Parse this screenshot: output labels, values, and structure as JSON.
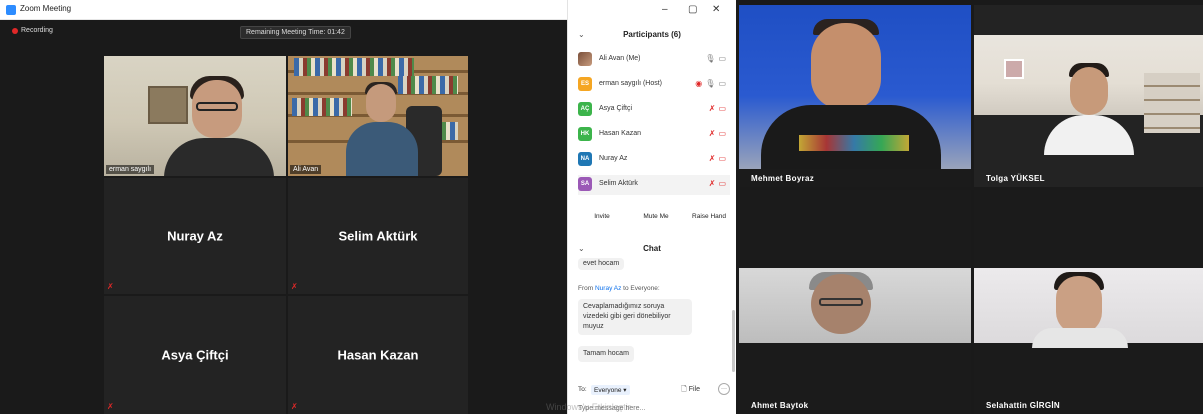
{
  "app": {
    "window_title": "Zoom Meeting",
    "recording_label": "Recording",
    "remaining_time": "Remaining Meeting Time: 01:42",
    "win_controls": {
      "minimize": "–",
      "restore": "▢",
      "close": "✕"
    }
  },
  "main_tiles": [
    {
      "name": "erman saygılı",
      "type": "video"
    },
    {
      "name": "Ali Avan",
      "type": "video"
    },
    {
      "name": "Nuray Az",
      "type": "name"
    },
    {
      "name": "Selim Aktürk",
      "type": "name"
    },
    {
      "name": "Asya Çiftçi",
      "type": "name"
    },
    {
      "name": "Hasan Kazan",
      "type": "name"
    }
  ],
  "participants": {
    "header": "Participants (6)",
    "list": [
      {
        "initials": "",
        "name": "Ali Avan (Me)",
        "color": ""
      },
      {
        "initials": "ES",
        "name": "erman saygılı (Host)",
        "color": "#f5a623"
      },
      {
        "initials": "AÇ",
        "name": "Asya Çiftçi",
        "color": "#3cb44b"
      },
      {
        "initials": "HK",
        "name": "Hasan Kazan",
        "color": "#3cb44b"
      },
      {
        "initials": "NA",
        "name": "Nuray Az",
        "color": "#1f77b4"
      },
      {
        "initials": "SA",
        "name": "Selim Aktürk",
        "color": "#9b59b6"
      }
    ],
    "buttons": {
      "invite": "Invite",
      "mute_me": "Mute Me",
      "raise_hand": "Raise Hand"
    }
  },
  "chat": {
    "header": "Chat",
    "messages": {
      "prev_tail": "evet hocam",
      "from_prefix": "From",
      "from_name": "Nuray Az",
      "from_suffix": "to Everyone:",
      "msg1": "Cevaplamadığımız soruya vizedeki gibi geri dönebiliyor muyuz",
      "msg2": "Tamam hocam"
    },
    "to_label": "To:",
    "recipient": "Everyone ▾",
    "file_label": "File",
    "more_label": "···",
    "input_placeholder": "Type message here..."
  },
  "watermark": "Windows'u Etkinleştir",
  "gallery": [
    {
      "name": "Mehmet Boyraz"
    },
    {
      "name": "Tolga YÜKSEL"
    },
    {
      "name": "Ahmet Baytok"
    },
    {
      "name": "Selahattin GİRGİN"
    }
  ],
  "colors": {
    "active_speaker": "#c4e35a",
    "speaking_outline": "#3ecf4a",
    "muted_red": "#e02828",
    "link_blue": "#0e71eb"
  }
}
